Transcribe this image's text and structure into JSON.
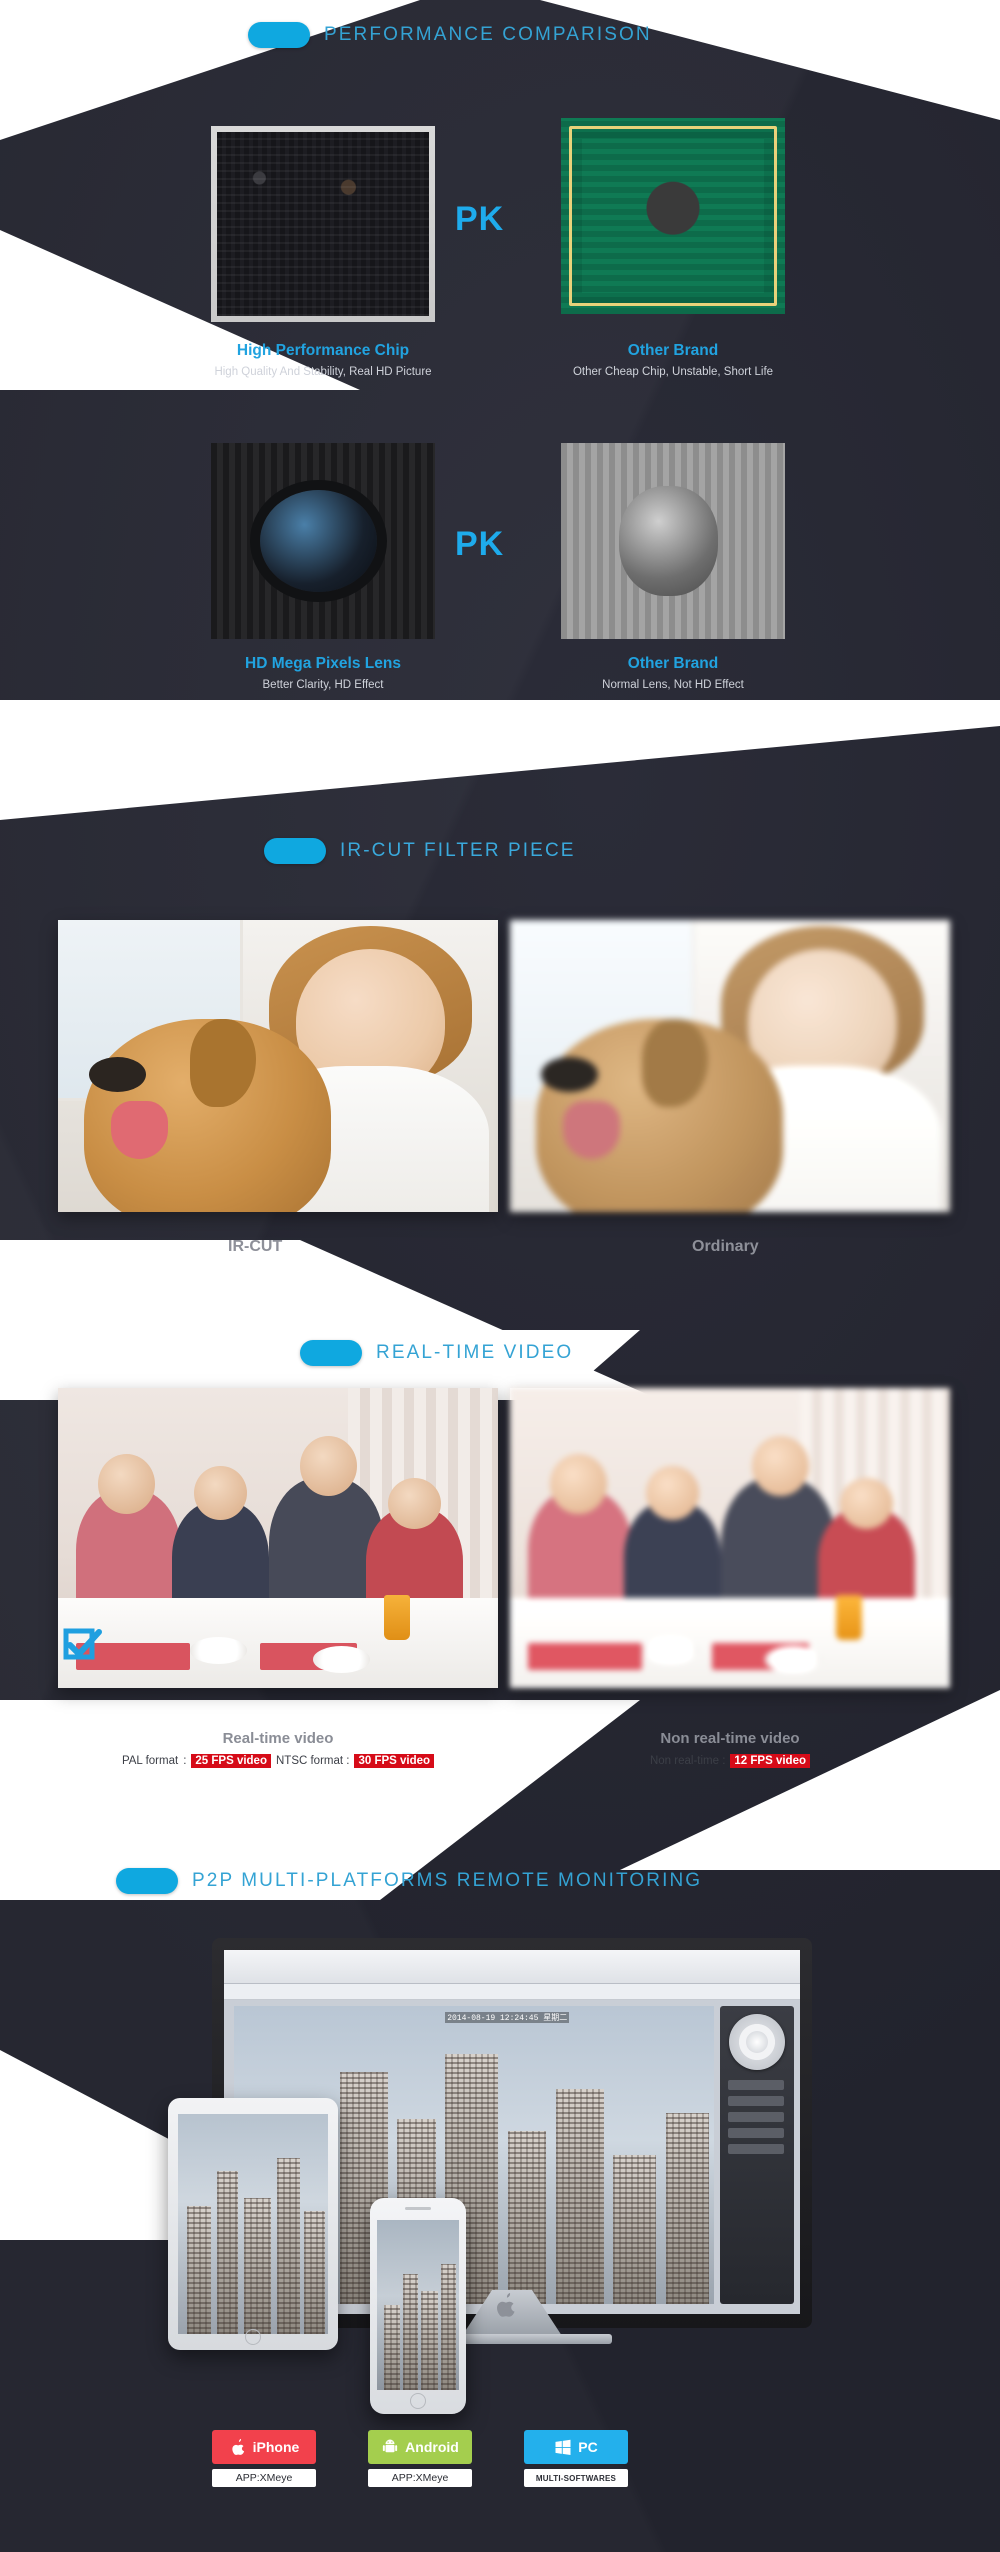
{
  "sections": [
    {
      "id": "performance",
      "title": "PERFORMANCE COMPARISON",
      "pk_label": "PK",
      "rows": [
        {
          "left_title": "High Performance Chip",
          "left_sub": "High Quality And Stability, Real HD Picture",
          "right_title": "Other Brand",
          "right_sub": "Other Cheap Chip, Unstable, Short Life"
        },
        {
          "left_title": "HD Mega Pixels Lens",
          "left_sub": "Better Clarity, HD Effect",
          "right_title": "Other Brand",
          "right_sub": "Normal Lens, Not HD Effect"
        }
      ]
    },
    {
      "id": "ircut",
      "title": "IR-CUT FILTER PIECE",
      "left_label": "IR-CUT",
      "right_label": "Ordinary"
    },
    {
      "id": "realtime",
      "title": "REAL-TIME VIDEO",
      "left_heading": "Real-time video",
      "left_line": {
        "pal_label": "PAL format",
        "pal_sep": ":",
        "pal_value": "25 FPS video",
        "ntsc_label": "NTSC format :",
        "ntsc_value": "30 FPS video"
      },
      "right_heading": "Non real-time video",
      "right_line": {
        "label": "Non real-time :",
        "value": "12 FPS video"
      }
    },
    {
      "id": "p2p",
      "title": "P2P MULTI-PLATFORMS REMOTE MONITORING",
      "osd_timestamp": "2014-08-19 12:24:45 星期二",
      "platforms": [
        {
          "name": "iPhone",
          "caption": "APP:XMeye",
          "color": "#f2414c",
          "icon": "apple-icon"
        },
        {
          "name": "Android",
          "caption": "APP:XMeye",
          "color": "#a4ce4e",
          "icon": "android-icon"
        },
        {
          "name": "PC",
          "caption": "MULTI-SOFTWARES",
          "color": "#23b0ec",
          "icon": "windows-icon"
        }
      ]
    }
  ],
  "colors": {
    "background": "#24252f",
    "accent_blue": "#0fa8e0",
    "title_blue": "#34a3d4",
    "caption_blue": "#21a3e0",
    "tag_red": "#d60b18",
    "gray_label": "#8e9099"
  }
}
